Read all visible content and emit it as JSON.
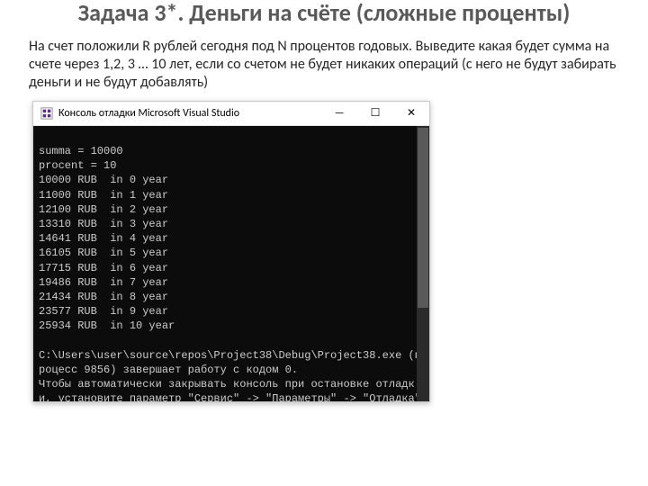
{
  "title": "Задача 3*. Деньги на счёте (сложные проценты)",
  "body": "На счет положили R рублей сегодня под N процентов годовых. Выведите какая будет сумма на счете через 1,2, 3 … 10 лет, если со счетом не будет никаких операций (с него не будут забирать деньги и не будут добавлять)",
  "window": {
    "title": "Консоль отладки Microsoft Visual Studio",
    "min": "—",
    "max": "☐",
    "close": "✕"
  },
  "console": {
    "summa_line": "summa = 10000",
    "procent_line": "procent = 10",
    "rows": [
      "10000 RUB  in 0 year",
      "11000 RUB  in 1 year",
      "12100 RUB  in 2 year",
      "13310 RUB  in 3 year",
      "14641 RUB  in 4 year",
      "16105 RUB  in 5 year",
      "17715 RUB  in 6 year",
      "19486 RUB  in 7 year",
      "21434 RUB  in 8 year",
      "23577 RUB  in 9 year",
      "25934 RUB  in 10 year"
    ],
    "path_line": "C:\\Users\\user\\source\\repos\\Project38\\Debug\\Project38.exe (процесс 9856) завершает работу с кодом 0.",
    "hint_line": "Чтобы автоматически закрывать консоль при остановке отладки, установите параметр \"Сервис\" -> \"Параметры\" -> \"Отладка\" -> \"Автоматически закрыть консоль при остановке отладки\"."
  }
}
